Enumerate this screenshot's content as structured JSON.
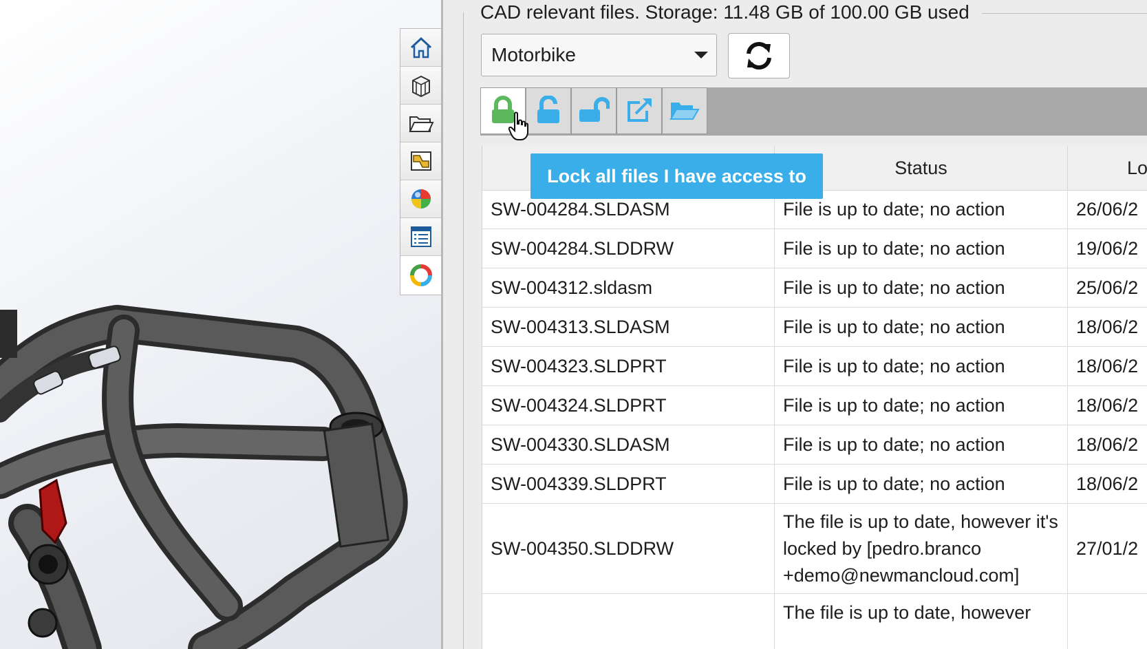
{
  "panel": {
    "storage_title": "CAD relevant files. Storage: 11.48 GB of 100.00 GB used",
    "project_selected": "Motorbike"
  },
  "task_pane": {
    "tabs": [
      {
        "name": "home",
        "icon": "home-icon"
      },
      {
        "name": "design-library",
        "icon": "cube-library-icon"
      },
      {
        "name": "file-explorer",
        "icon": "folder-open-icon"
      },
      {
        "name": "view-palette",
        "icon": "view-palette-icon"
      },
      {
        "name": "appearances",
        "icon": "color-ball-icon"
      },
      {
        "name": "custom-properties",
        "icon": "list-icon"
      },
      {
        "name": "newman-cloud",
        "icon": "ring-logo-icon"
      }
    ]
  },
  "toolbar": {
    "buttons": [
      {
        "name": "lock-all",
        "icon": "lock-closed-icon",
        "color": "#5cb85c"
      },
      {
        "name": "unlock",
        "icon": "lock-open-icon",
        "color": "#3aaee8"
      },
      {
        "name": "unlock-all",
        "icon": "lock-open-wide-icon",
        "color": "#3aaee8"
      },
      {
        "name": "open-external",
        "icon": "external-link-icon",
        "color": "#3aaee8"
      },
      {
        "name": "open-folder",
        "icon": "folder-open-icon",
        "color": "#3aaee8"
      }
    ]
  },
  "tooltip": {
    "text": "Lock all files I have access to"
  },
  "table": {
    "columns": [
      "",
      "Status",
      "Lo"
    ],
    "rows": [
      {
        "file": "SW-004284.SLDASM",
        "status": "File is up to date; no action",
        "date": "26/06/2"
      },
      {
        "file": "SW-004284.SLDDRW",
        "status": "File is up to date; no action",
        "date": "19/06/2"
      },
      {
        "file": "SW-004312.sldasm",
        "status": "File is up to date; no action",
        "date": "25/06/2"
      },
      {
        "file": "SW-004313.SLDASM",
        "status": "File is up to date; no action",
        "date": "18/06/2"
      },
      {
        "file": "SW-004323.SLDPRT",
        "status": "File is up to date; no action",
        "date": "18/06/2"
      },
      {
        "file": "SW-004324.SLDPRT",
        "status": "File is up to date; no action",
        "date": "18/06/2"
      },
      {
        "file": "SW-004330.SLDASM",
        "status": "File is up to date; no action",
        "date": "18/06/2"
      },
      {
        "file": "SW-004339.SLDPRT",
        "status": "File is up to date; no action",
        "date": "18/06/2"
      },
      {
        "file": "SW-004350.SLDDRW",
        "status": "The file is up to date, however it's locked by [pedro.branco +demo@newmancloud.com]",
        "date": "27/01/2"
      },
      {
        "file": "",
        "status": "The file is up to date, however",
        "date": ""
      }
    ]
  }
}
